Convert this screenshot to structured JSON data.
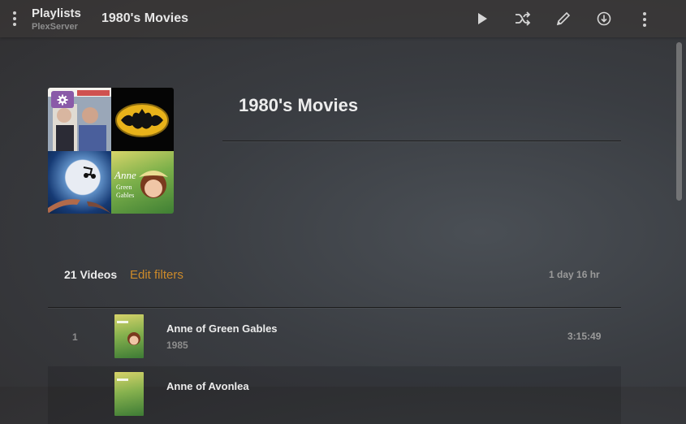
{
  "header": {
    "section_title": "Playlists",
    "server_name": "PlexServer",
    "title": "1980's Movies"
  },
  "toolbar": {
    "buttons": [
      "play-icon",
      "shuffle-icon",
      "edit-pencil-icon",
      "download-icon",
      "more-vertical-icon"
    ]
  },
  "playlist": {
    "title": "1980's Movies",
    "poster_tiles": [
      "Planes, Trains & Automobiles",
      "Batman",
      "E.T.",
      "Anne of Green Gables"
    ],
    "count_label": "21 Videos",
    "edit_filters_label": "Edit filters",
    "total_duration": "1 day 16 hr"
  },
  "items": [
    {
      "index": "1",
      "title": "Anne of Green Gables",
      "year": "1985",
      "duration": "3:15:49"
    },
    {
      "index": "",
      "title": "Anne of Avonlea",
      "year": "",
      "duration": ""
    }
  ],
  "colors": {
    "accent": "#cc8a2a",
    "badge": "#8a5aa8"
  }
}
